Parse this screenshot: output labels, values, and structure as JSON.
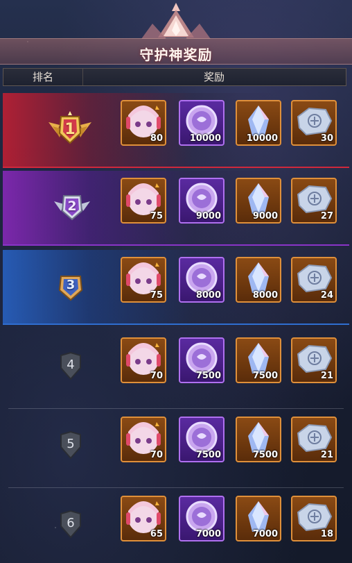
{
  "header": {
    "title": "守护神奖励"
  },
  "columns": {
    "rank": "排名",
    "reward": "奖励"
  },
  "rows": [
    {
      "rank": "1",
      "rewards": [
        "80",
        "10000",
        "10000",
        "30"
      ]
    },
    {
      "rank": "2",
      "rewards": [
        "75",
        "9000",
        "9000",
        "27"
      ]
    },
    {
      "rank": "3",
      "rewards": [
        "75",
        "8000",
        "8000",
        "24"
      ]
    },
    {
      "rank": "4",
      "rewards": [
        "70",
        "7500",
        "7500",
        "21"
      ]
    },
    {
      "rank": "5",
      "rewards": [
        "70",
        "7500",
        "7500",
        "21"
      ]
    },
    {
      "rank": "6",
      "rewards": [
        "65",
        "7000",
        "7000",
        "18"
      ]
    }
  ],
  "reward_icons": [
    "character-portrait-icon",
    "purple-coin-icon",
    "crystal-shard-icon",
    "silver-ore-icon"
  ],
  "colors": {
    "rank1": "#d0283c",
    "rank2": "#8a34c8",
    "rank3": "#2f6ed0",
    "item_frame_gold": "#e0903a",
    "item_frame_purple": "#b070f0"
  }
}
